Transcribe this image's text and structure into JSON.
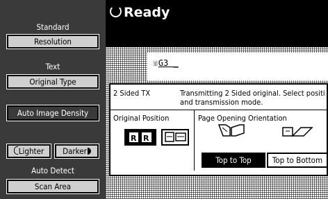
{
  "sidebar": {
    "standard_label": "Standard",
    "resolution_label": "Resolution",
    "text_label": "Text",
    "original_type_label": "Original Type",
    "auto_image_density_label": "Auto Image Density",
    "lighter_label": "Lighter",
    "darker_label": "Darker",
    "auto_detect_label": "Auto Detect",
    "scan_area_label": "Scan Area"
  },
  "status": {
    "text": "Ready"
  },
  "dial": {
    "text": "G3 _"
  },
  "panel": {
    "mode_label": "2 Sided TX",
    "message": "Transmitting 2 Sided original. Select positi and transmission mode.",
    "original_position_label": "Original Position",
    "page_opening_label": "Page Opening Orientation",
    "top_to_top_label": "Top to Top",
    "top_to_bottom_label": "Top to Bottom"
  }
}
